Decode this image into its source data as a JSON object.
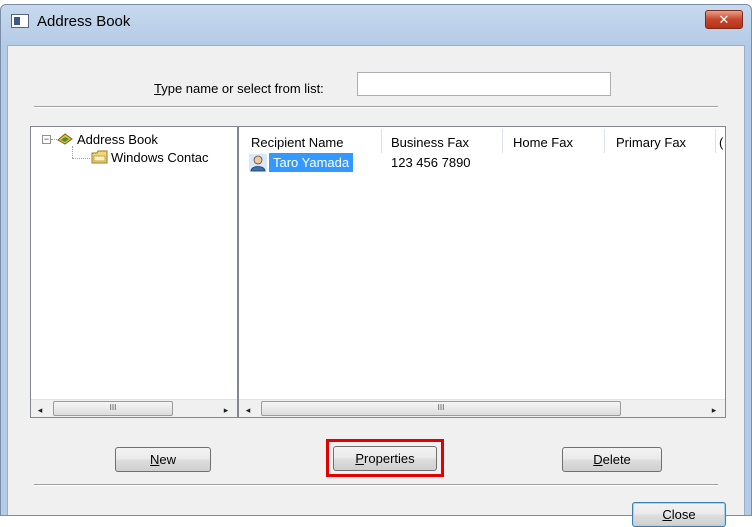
{
  "window": {
    "title": "Address Book",
    "close_glyph": "✕"
  },
  "search": {
    "label_ul": "T",
    "label_rest": "ype name or select from list:",
    "value": "",
    "placeholder": ""
  },
  "tree": {
    "expander": "−",
    "root": "Address Book",
    "child": "Windows Contac",
    "scroll_left": "◂",
    "scroll_right": "▸",
    "thumb_grip": "III"
  },
  "list": {
    "columns": [
      "Recipient Name",
      "Business Fax",
      "Home Fax",
      "Primary Fax",
      "("
    ],
    "rows": [
      {
        "recipient": "Taro Yamada",
        "business_fax": "123 456 7890",
        "home_fax": "",
        "primary_fax": ""
      }
    ],
    "scroll_left": "◂",
    "scroll_right": "▸",
    "thumb_grip": "III"
  },
  "buttons": {
    "new_ul": "N",
    "new_rest": "ew",
    "properties_ul": "P",
    "properties_rest": "roperties",
    "delete_ul": "D",
    "delete_rest": "elete",
    "close_ul": "C",
    "close_rest": "lose"
  },
  "icons": {
    "app": "address-book-app-icon",
    "tree_root": "address-book-icon",
    "tree_child": "folder-icon",
    "contact": "person-icon"
  },
  "colors": {
    "selection": "#3399ff",
    "highlight": "#e30000",
    "close_button": "#c7472b"
  }
}
